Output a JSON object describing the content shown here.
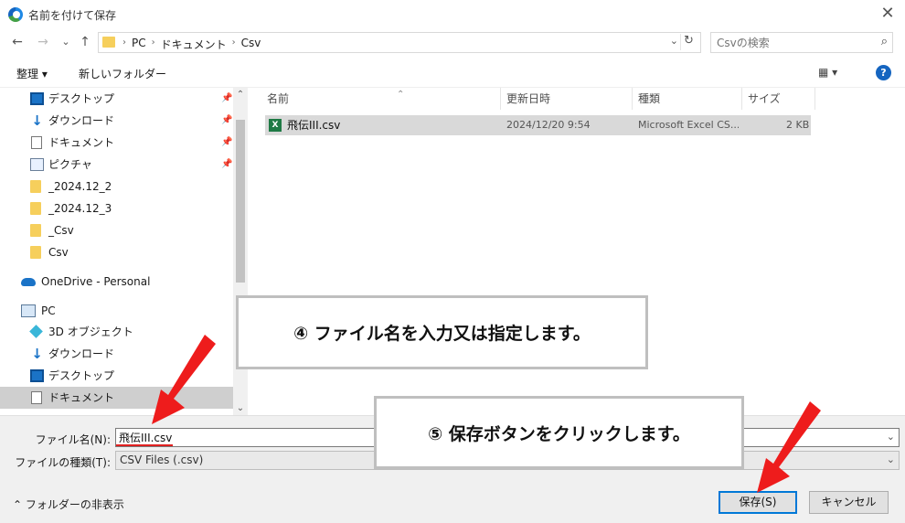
{
  "window": {
    "title": "名前を付けて保存",
    "close_glyph": "✕"
  },
  "nav": {
    "back": "←",
    "forward": "→",
    "recent": "⌄",
    "up": "↑"
  },
  "address": {
    "crumbs": [
      "PC",
      "ドキュメント",
      "Csv"
    ],
    "separator": "›",
    "dropdown": "⌄",
    "refresh": "↻"
  },
  "search": {
    "placeholder": "Csvの検索",
    "icon": "⌕"
  },
  "toolbar": {
    "organize": "整理 ▾",
    "new_folder": "新しいフォルダー",
    "view": "▦ ▾",
    "help": "?"
  },
  "nav_pane": {
    "items": [
      {
        "label": "デスクトップ",
        "icon": "desktop-icon",
        "pinned": true,
        "selected": false
      },
      {
        "label": "ダウンロード",
        "icon": "download-icon",
        "pinned": true,
        "selected": false
      },
      {
        "label": "ドキュメント",
        "icon": "document-icon",
        "pinned": true,
        "selected": false
      },
      {
        "label": "ピクチャ",
        "icon": "pictures-icon",
        "pinned": true,
        "selected": false
      },
      {
        "label": "_2024.12_2",
        "icon": "folder-icon",
        "pinned": false,
        "selected": false
      },
      {
        "label": "_2024.12_3",
        "icon": "folder-icon",
        "pinned": false,
        "selected": false
      },
      {
        "label": "_Csv",
        "icon": "folder-icon",
        "pinned": false,
        "selected": false
      },
      {
        "label": "Csv",
        "icon": "folder-icon",
        "pinned": false,
        "selected": false
      },
      {
        "label": "OneDrive - Personal",
        "icon": "onedrive-icon",
        "pinned": false,
        "selected": false
      },
      {
        "label": "PC",
        "icon": "pc-icon",
        "pinned": false,
        "selected": false
      },
      {
        "label": "3D オブジェクト",
        "icon": "3d-objects-icon",
        "pinned": false,
        "selected": false
      },
      {
        "label": "ダウンロード",
        "icon": "download-icon",
        "pinned": false,
        "selected": false
      },
      {
        "label": "デスクトップ",
        "icon": "desktop-icon",
        "pinned": false,
        "selected": false
      },
      {
        "label": "ドキュメント",
        "icon": "document-icon",
        "pinned": false,
        "selected": true
      }
    ],
    "pin_glyph": "📌"
  },
  "columns": {
    "name": "名前",
    "modified": "更新日時",
    "type": "種類",
    "size": "サイズ",
    "sort_glyph": "⌃"
  },
  "files": [
    {
      "name": "飛伝III.csv",
      "modified": "2024/12/20 9:54",
      "type": "Microsoft Excel CS...",
      "size": "2 KB",
      "icon_letter": "X"
    }
  ],
  "form": {
    "filename_label": "ファイル名(N):",
    "filename_value": "飛伝III.csv",
    "filetype_label": "ファイルの種類(T):",
    "filetype_value": "CSV Files (.csv)",
    "hide_folders": "⌃  フォルダーの非表示",
    "save": "保存(S)",
    "cancel": "キャンセル"
  },
  "callouts": {
    "step4": "④ ファイル名を入力又は指定します。",
    "step5": "⑤ 保存ボタンをクリックします。"
  },
  "colors": {
    "arrow": "#ee1c1c",
    "accent": "#0078d7",
    "selected_row": "#d9d9d9",
    "callout_border": "#bfbfbf"
  }
}
